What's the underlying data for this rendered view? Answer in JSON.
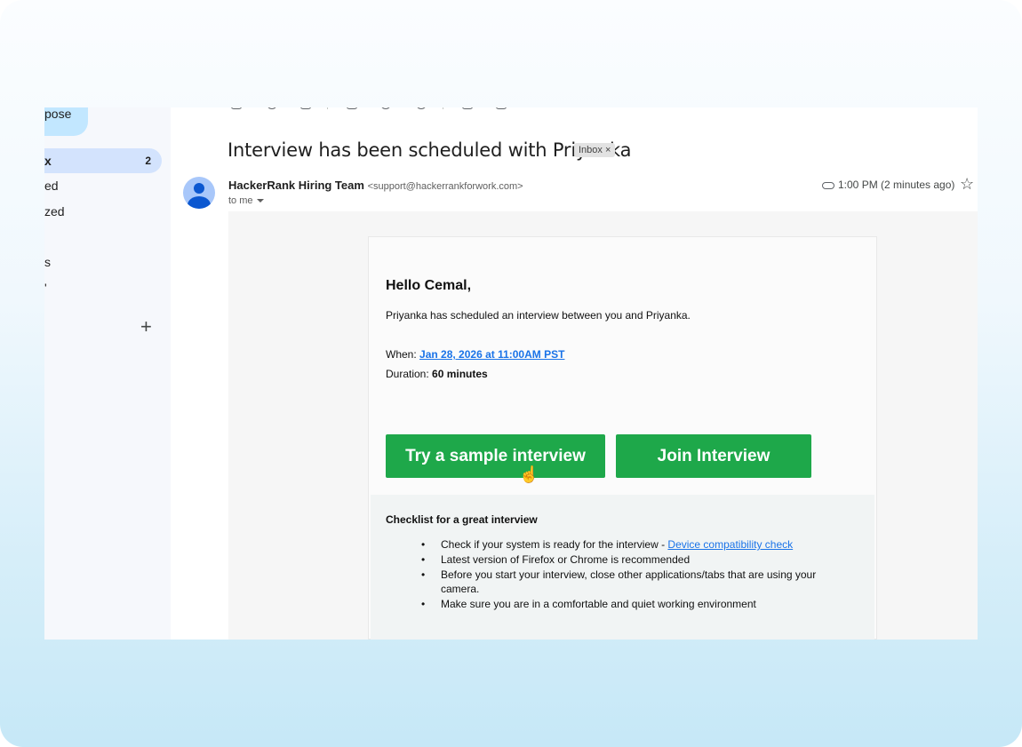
{
  "sidebar": {
    "compose_label": "pose",
    "items": [
      {
        "label": "x",
        "count": "2",
        "active": true
      },
      {
        "label": "ed"
      },
      {
        "label": "zed"
      },
      {
        "label": "s"
      },
      {
        "label": "'"
      }
    ],
    "add_label": "+"
  },
  "email": {
    "subject": "Interview has been scheduled with Priyanka",
    "label_chip": "Inbox ×",
    "sender_name": "HackerRank Hiring Team",
    "sender_email": "<support@hackerrankforwork.com>",
    "recipient": "to me",
    "time": "1:00 PM (2 minutes ago)",
    "star_icon": "☆"
  },
  "message": {
    "greeting": "Hello Cemal,",
    "intro": "Priyanka has scheduled an interview between you and Priyanka.",
    "when_label": "When: ",
    "when_value": "Jan 28, 2026 at 11:00AM PST",
    "duration_label": "Duration: ",
    "duration_value": "60 minutes",
    "sample_button": "Try a sample interview",
    "join_button": "Join Interview",
    "checklist_title": "Checklist for a great interview",
    "checklist": [
      {
        "text": "Check if your system is ready for the interview - ",
        "link": "Device compatibility check"
      },
      {
        "text": "Latest version of Firefox or Chrome is recommended"
      },
      {
        "text": "Before you start your interview, close other applications/tabs that are using your camera."
      },
      {
        "text": "Make sure you are in a comfortable and quiet working environment"
      }
    ]
  },
  "colors": {
    "button_green": "#1ea84a",
    "link_blue": "#1a73e8",
    "active_nav": "#d3e3fd"
  }
}
